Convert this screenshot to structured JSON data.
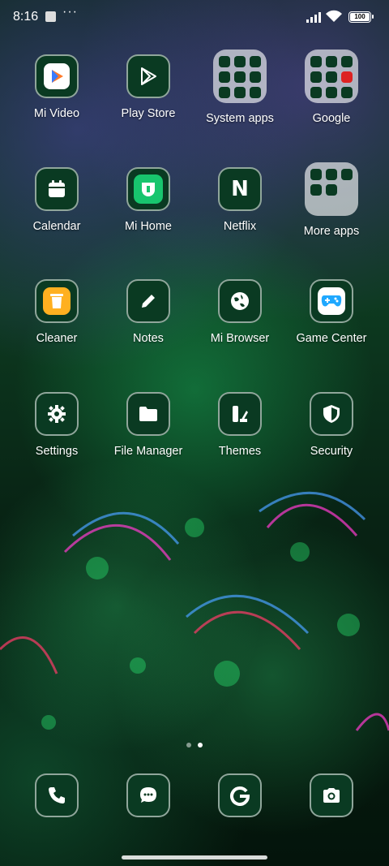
{
  "status_bar": {
    "time": "8:16",
    "more": "···",
    "battery": "100"
  },
  "apps": [
    {
      "label": "Mi Video",
      "icon": "mi-video-icon"
    },
    {
      "label": "Play Store",
      "icon": "play-store-icon"
    },
    {
      "label": "System apps",
      "icon": "folder-icon"
    },
    {
      "label": "Google",
      "icon": "folder-icon"
    },
    {
      "label": "Calendar",
      "icon": "calendar-icon"
    },
    {
      "label": "Mi Home",
      "icon": "mi-home-icon"
    },
    {
      "label": "Netflix",
      "icon": "netflix-icon",
      "glyph": "N"
    },
    {
      "label": "More apps",
      "icon": "folder-icon"
    },
    {
      "label": "Cleaner",
      "icon": "cleaner-icon"
    },
    {
      "label": "Notes",
      "icon": "pencil-icon"
    },
    {
      "label": "Mi Browser",
      "icon": "globe-icon"
    },
    {
      "label": "Game Center",
      "icon": "gamepad-icon"
    },
    {
      "label": "Settings",
      "icon": "gear-icon"
    },
    {
      "label": "File Manager",
      "icon": "folder-icon"
    },
    {
      "label": "Themes",
      "icon": "themes-icon"
    },
    {
      "label": "Security",
      "icon": "shield-icon"
    }
  ],
  "dock": [
    {
      "icon": "phone-icon"
    },
    {
      "icon": "messages-icon"
    },
    {
      "icon": "google-icon"
    },
    {
      "icon": "camera-icon"
    }
  ],
  "page_indicator": {
    "pages": 2,
    "active": 2
  },
  "colors": {
    "icon_bg": "#0a3a22",
    "folder_bg": "#ffffffa0",
    "accent_green": "#18c56e"
  }
}
